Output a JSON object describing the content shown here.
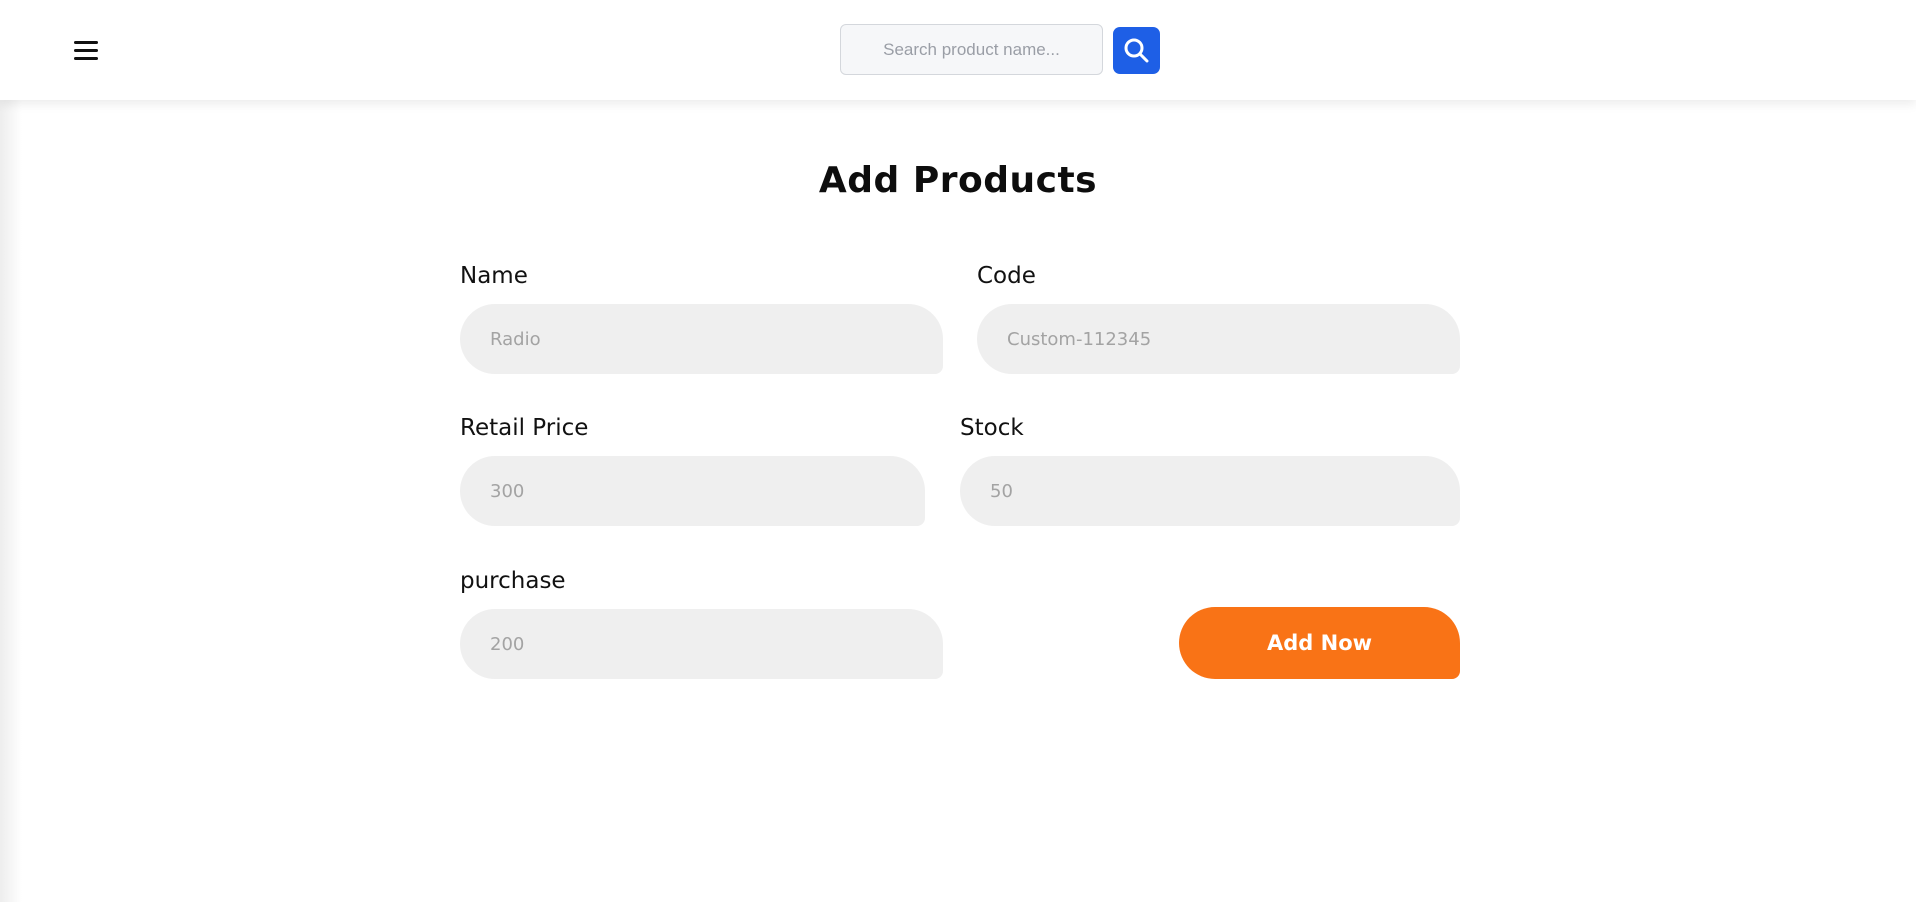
{
  "header": {
    "search": {
      "placeholder": "Search product name...",
      "value": ""
    },
    "menu_icon": "hamburger-menu-icon",
    "search_icon": "magnifier-icon",
    "accent_color": "#1e5fe6"
  },
  "page": {
    "title": "Add Products"
  },
  "form": {
    "name": {
      "label": "Name",
      "placeholder": "Radio",
      "value": ""
    },
    "code": {
      "label": "Code",
      "placeholder": "Custom-112345",
      "value": ""
    },
    "retail_price": {
      "label": "Retail Price",
      "placeholder": "300",
      "value": ""
    },
    "stock": {
      "label": "Stock",
      "placeholder": "50",
      "value": ""
    },
    "purchase": {
      "label": "purchase",
      "placeholder": "200",
      "value": ""
    },
    "submit_label": "Add Now",
    "submit_color": "#f97316",
    "field_background": "#efefef"
  }
}
